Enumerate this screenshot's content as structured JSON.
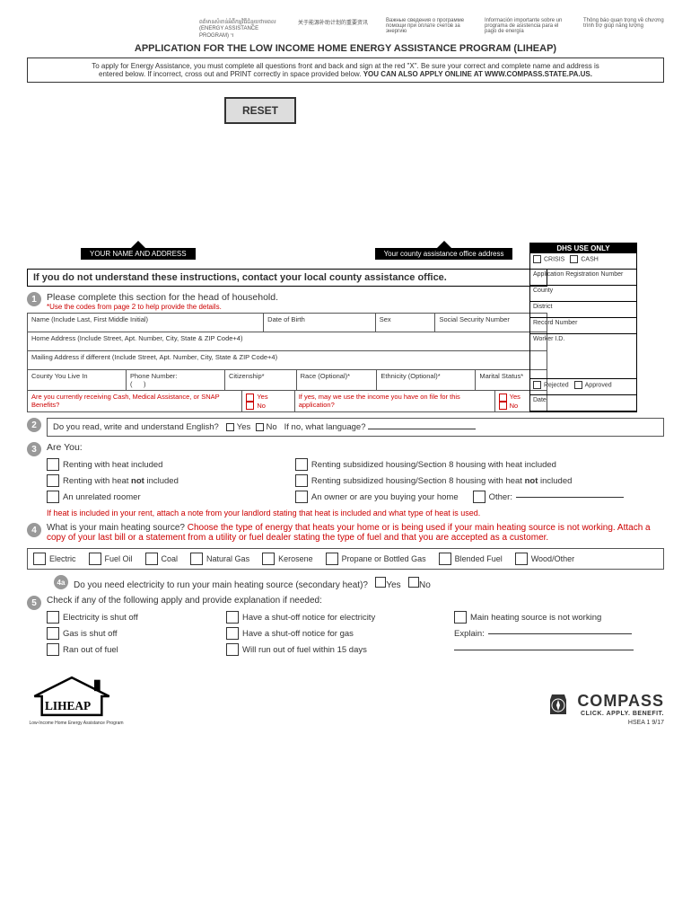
{
  "languages": {
    "l1": "ពត៌មានសំខាន់អំពីកម្មវិធីជំនួយថាមពល (ENERGY ASSISTANCE PROGRAM) ។",
    "l2": "关于能源补助计划的重要资讯",
    "l3": "Важные сведения о программе помощи при оплате счетов за энергию",
    "l4": "Información importante sobre un programa de asistencia para el pago de energía",
    "l5": "Thông báo quan trọng về chương trình trợ giúp năng lượng"
  },
  "title": "APPLICATION FOR THE LOW INCOME HOME ENERGY ASSISTANCE PROGRAM (LIHEAP)",
  "instructions": {
    "line1": "To apply for Energy Assistance, you must complete all questions front and back and sign at the red \"X\". Be sure your correct and complete name and address is",
    "line2": "entered below. If incorrect, cross out and PRINT correctly in space provided below. ",
    "bold": "YOU CAN ALSO APPLY ONLINE AT WWW.COMPASS.STATE.PA.US."
  },
  "reset": "RESET",
  "arrows": {
    "left": "YOUR NAME AND ADDRESS",
    "right": "Your county assistance office address"
  },
  "dhs": {
    "hdr": "DHS USE ONLY",
    "crisis": "CRISIS",
    "cash": "CASH",
    "appreg": "Application Registration Number",
    "county": "County",
    "district": "District",
    "record": "Record Number",
    "worker": "Worker I.D.",
    "rejected": "Rejected",
    "approved": "Approved",
    "date": "Date"
  },
  "notice": "If you do not understand these instructions, contact your local county assistance office.",
  "s1": {
    "title": "Please complete this section for the head of household.",
    "hint": "*Use the codes from page 2 to help provide the details.",
    "name": "Name (Include Last, First Middle Initial)",
    "dob": "Date of Birth",
    "sex": "Sex",
    "ssn": "Social Security Number",
    "home": "Home Address (Include Street, Apt. Number, City, State & ZIP Code+4)",
    "mail": "Mailing Address if different (Include Street, Apt. Number, City, State & ZIP Code+4)",
    "county": "County You Live In",
    "phone": "Phone Number:",
    "citizen": "Citizenship*",
    "race": "Race (Optional)*",
    "ethnicity": "Ethnicity (Optional)*",
    "marital": "Marital Status*",
    "snap": "Are you currently receiving Cash, Medical Assistance, or SNAP Benefits?",
    "ifyes": "If yes, may we use the income you have on file for this application?",
    "yes": "Yes",
    "no": "No"
  },
  "s2": {
    "q": "Do you read, write and understand English?",
    "yes": "Yes",
    "no": "No",
    "ifno": "If no, what language?"
  },
  "s3": {
    "q": "Are You:",
    "a1": "Renting with heat included",
    "a2": "Renting subsidized housing/Section 8 housing with heat included",
    "a3": "Renting with heat ",
    "a3b": "not",
    "a3c": " included",
    "a4": "Renting subsidized housing/Section 8 housing with heat ",
    "a4b": "not",
    "a4c": " included",
    "a5": "An unrelated roomer",
    "a6": "An owner or are you buying your home",
    "other": "Other:",
    "note": "If heat is included in your rent, attach a note from your landlord stating that heat is included and what type of heat is used."
  },
  "s4": {
    "q": "What is your main heating source? ",
    "hint": "Choose the type of energy that heats your home or is being used if your main heating source is not working. Attach a copy of your last bill or a statement from a utility or fuel dealer stating the type of fuel and that you are accepted as a customer.",
    "opts": [
      "Electric",
      "Fuel Oil",
      "Coal",
      "Natural Gas",
      "Kerosene",
      "Propane or Bottled Gas",
      "Blended Fuel",
      "Wood/Other"
    ]
  },
  "s4a": {
    "q": "Do you need electricity to run your main heating source (secondary heat)?",
    "yes": "Yes",
    "no": "No"
  },
  "s5": {
    "q": "Check if any of the following apply and provide explanation if needed:",
    "a1": "Electricity is shut off",
    "a2": "Have a shut-off notice for electricity",
    "a3": "Main heating source is not working",
    "a4": "Gas is shut off",
    "a5": "Have a shut-off notice for gas",
    "explain": "Explain:",
    "a6": "Ran out of fuel",
    "a7": "Will run out of fuel within 15 days"
  },
  "footer": {
    "liheap_sub": "Low-Income Home Energy Assistance Program",
    "compass": "COMPASS",
    "tagline": "CLICK. APPLY. BENEFIT.",
    "formid": "HSEA 1   9/17"
  }
}
